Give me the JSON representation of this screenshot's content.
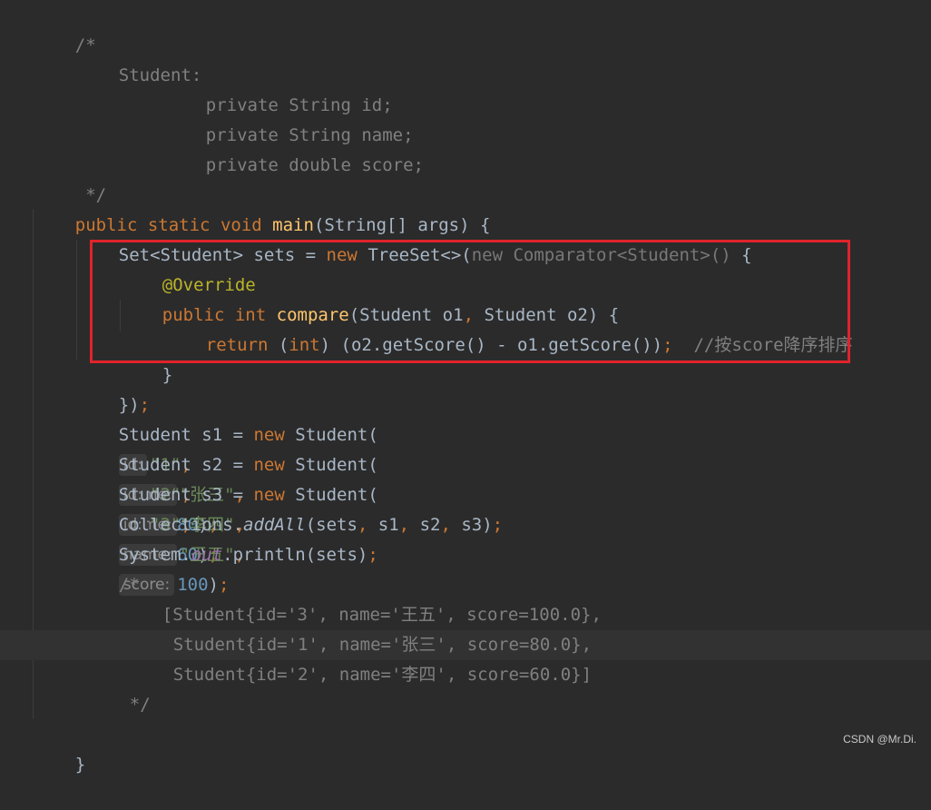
{
  "code": {
    "l1": "/*",
    "l2": "Student:",
    "l3": "private String id;",
    "l4": "private String name;",
    "l5": "private double score;",
    "l6": " */",
    "l7": {
      "public": "public",
      "static": "static",
      "void": "void",
      "main": "main",
      "rest": "(String[] args) {"
    },
    "l8": {
      "a": "Set<Student> sets = ",
      "new": "new",
      "b": " TreeSet<>(",
      "c": "new Comparator<Student>()",
      "d": " {"
    },
    "l9": "@Override",
    "l10": {
      "public": "public",
      "int": "int",
      "compare": "compare",
      "a": "(Student o1",
      "comma": ",",
      "b": " Student o2) {"
    },
    "l11": {
      "return": "return",
      "a": " (",
      "int": "int",
      "b": ") (o2.getScore() - o1.getScore())",
      "semi": ";",
      "comment": "  //按score降序排序"
    },
    "l12": "}",
    "l13": {
      "a": "})",
      "semi": ";"
    },
    "students": [
      {
        "prefix": "Student s1 = ",
        "id": "\"1\"",
        "name": "\"张三\"",
        "score": "80"
      },
      {
        "prefix": "Student s2 = ",
        "id": "\"2\"",
        "name": "\"李四\"",
        "score": "60"
      },
      {
        "prefix": "Student s3 = ",
        "id": "\"3\"",
        "name": "\"王五\"",
        "score": "100"
      }
    ],
    "new_kw": "new",
    "student_ctor": " Student(",
    "hint_id": "id:",
    "hint_name": "name:",
    "hint_score": "score:",
    "l17": {
      "a": "Collections.",
      "b": "addAll",
      "c": "(sets",
      "c1": ",",
      "d": " s1",
      "d1": ",",
      "e": " s2",
      "e1": ",",
      "f": " s3)",
      "semi": ";"
    },
    "l18": {
      "a": "System.",
      "b": "out",
      "c": ".println(sets)",
      "semi": ";"
    },
    "l19": "/*",
    "l20": "[Student{id='3', name='王五', score=100.0},",
    "l21": "Student{id='1', name='张三', score=80.0},",
    "l22": "Student{id='2', name='李四', score=60.0}]",
    "l23": "*/",
    "l25": "}"
  },
  "watermark": "CSDN @Mr.Di."
}
